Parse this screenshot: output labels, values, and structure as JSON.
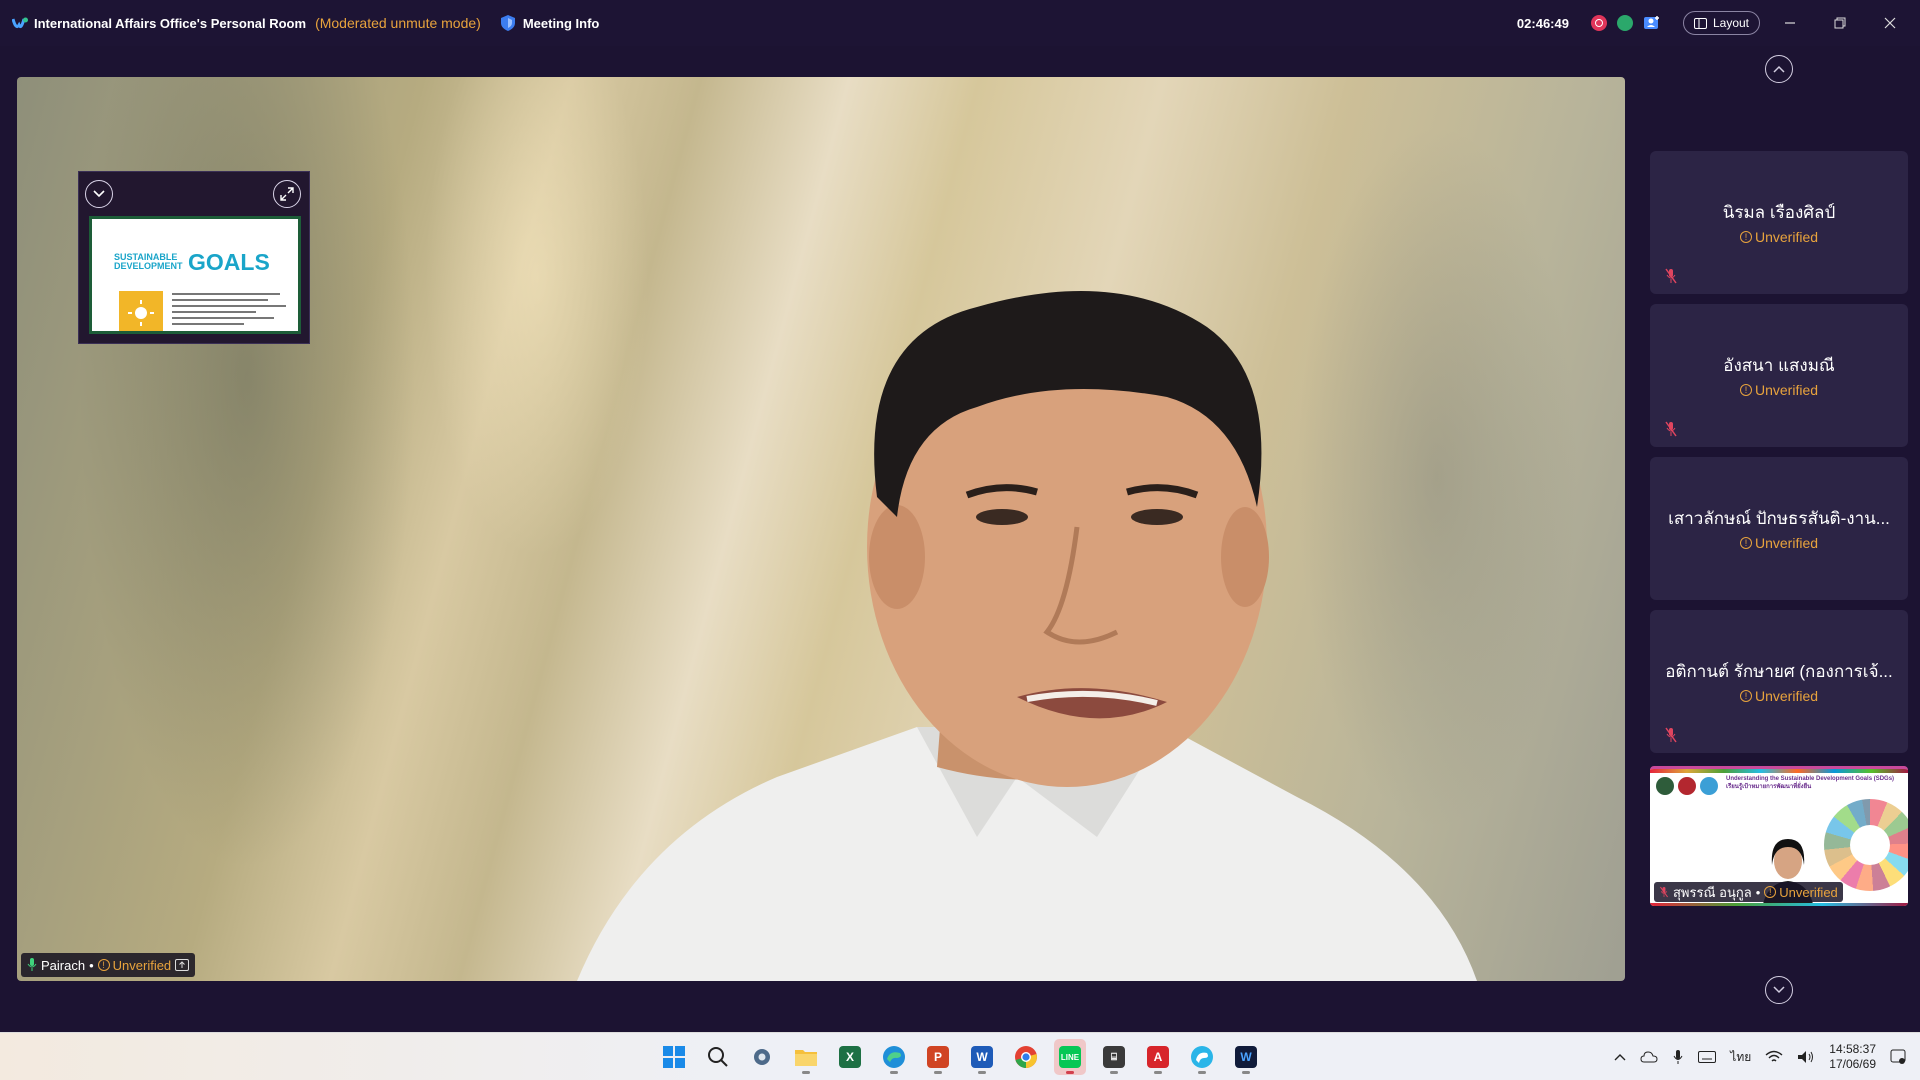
{
  "titlebar": {
    "room_title": "International Affairs Office's Personal Room",
    "mode": "(Moderated unmute mode)",
    "meeting_info": "Meeting Info",
    "elapsed": "02:46:49",
    "layout_label": "Layout"
  },
  "main_video": {
    "speaker_name": "Pairach",
    "speaker_status": "Unverified",
    "pip_slide": {
      "line1": "SUSTAINABLE",
      "line2": "DEVELOPMENT",
      "goals": "GOALS"
    }
  },
  "participants": [
    {
      "name": "นิรมล เรืองศิลป์",
      "status": "Unverified"
    },
    {
      "name": "อังสนา แสงมณี",
      "status": "Unverified"
    },
    {
      "name": "เสาวลักษณ์ ปักษธรสันติ-งาน...",
      "status": "Unverified"
    },
    {
      "name": "อติกานต์ รักษายศ (กองการเจ้...",
      "status": "Unverified"
    }
  ],
  "share_tile": {
    "name": "สุพรรณี อนุกูล",
    "status": "Unverified",
    "slide_head_1": "Understanding the Sustainable Development Goals (SDGs)",
    "slide_head_2": "เรียนรู้เป้าหมายการพัฒนาที่ยั่งยืน"
  },
  "taskbar": {
    "icons": [
      "windows-start-icon",
      "search-icon",
      "settings-icon",
      "file-explorer-icon",
      "excel-icon",
      "edge-icon",
      "powerpoint-icon",
      "word-icon",
      "chrome-icon",
      "line-icon",
      "calculator-icon",
      "acrobat-icon",
      "edge-beta-icon",
      "webex-icon"
    ],
    "time": "14:58:37",
    "date": "17/06/69",
    "language": "ไทย"
  },
  "colors": {
    "background": "#1c1332",
    "tile": "#2c2445",
    "warning": "#e8a33d"
  }
}
